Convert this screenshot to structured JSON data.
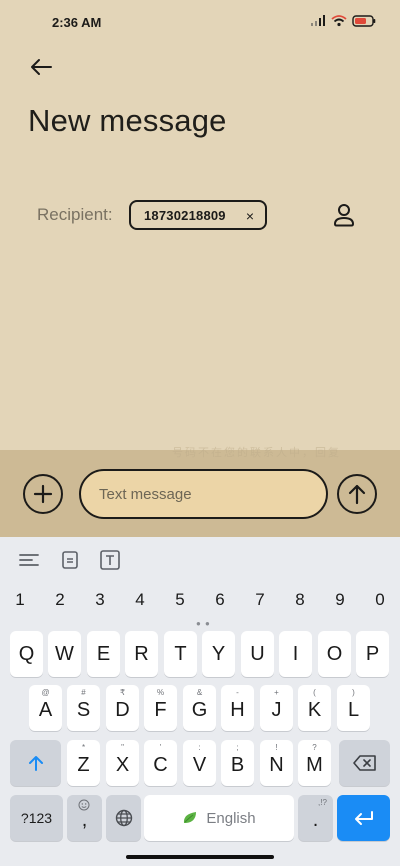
{
  "status_bar": {
    "time": "2:36 AM"
  },
  "header": {
    "title": "New message"
  },
  "recipient": {
    "label": "Recipient:",
    "chip_number": "18730218809",
    "chip_remove": "×"
  },
  "compose": {
    "placeholder": "Text message",
    "faded_hint": "号码不在您的联系人中，回复"
  },
  "keyboard": {
    "numbers": [
      "1",
      "2",
      "3",
      "4",
      "5",
      "6",
      "7",
      "8",
      "9",
      "0"
    ],
    "row1": [
      "Q",
      "W",
      "E",
      "R",
      "T",
      "Y",
      "U",
      "I",
      "O",
      "P"
    ],
    "row2": [
      {
        "main": "A",
        "sub": "@"
      },
      {
        "main": "S",
        "sub": "#"
      },
      {
        "main": "D",
        "sub": "₹"
      },
      {
        "main": "F",
        "sub": "%"
      },
      {
        "main": "G",
        "sub": "&"
      },
      {
        "main": "H",
        "sub": "-"
      },
      {
        "main": "J",
        "sub": "+"
      },
      {
        "main": "K",
        "sub": "("
      },
      {
        "main": "L",
        "sub": ")"
      }
    ],
    "row3": [
      {
        "main": "Z",
        "sub": "*"
      },
      {
        "main": "X",
        "sub": "\""
      },
      {
        "main": "C",
        "sub": "'"
      },
      {
        "main": "V",
        "sub": ":"
      },
      {
        "main": "B",
        "sub": ";"
      },
      {
        "main": "N",
        "sub": "!"
      },
      {
        "main": "M",
        "sub": "?"
      }
    ],
    "symbols_label": "?123",
    "comma_label": ",",
    "space_label": "English",
    "period_label": ".",
    "period_sub": ",!?"
  },
  "colors": {
    "background": "#e3d5b8",
    "compose_bar": "#cdba95",
    "input_fill": "#ecd5a7",
    "enter_key": "#1a8cf5"
  }
}
